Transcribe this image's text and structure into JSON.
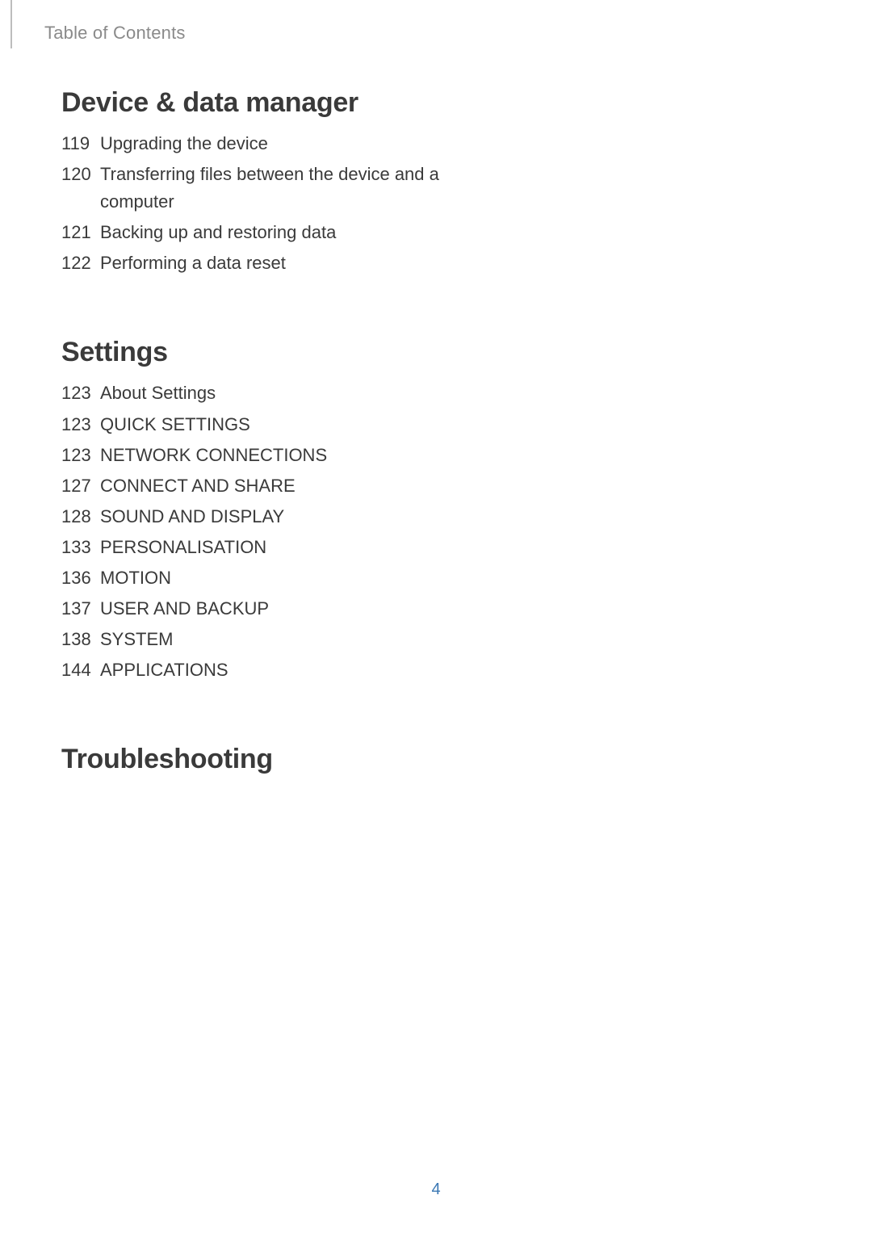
{
  "header": "Table of Contents",
  "sections": [
    {
      "title": "Device & data manager",
      "items": [
        {
          "page": "119",
          "text": "Upgrading the device"
        },
        {
          "page": "120",
          "text": "Transferring files between the device and a computer"
        },
        {
          "page": "121",
          "text": "Backing up and restoring data"
        },
        {
          "page": "122",
          "text": "Performing a data reset"
        }
      ]
    },
    {
      "title": "Settings",
      "items": [
        {
          "page": "123",
          "text": "About Settings"
        },
        {
          "page": "123",
          "text": "QUICK SETTINGS"
        },
        {
          "page": "123",
          "text": "NETWORK CONNECTIONS"
        },
        {
          "page": "127",
          "text": "CONNECT AND SHARE"
        },
        {
          "page": "128",
          "text": "SOUND AND DISPLAY"
        },
        {
          "page": "133",
          "text": "PERSONALISATION"
        },
        {
          "page": "136",
          "text": "MOTION"
        },
        {
          "page": "137",
          "text": "USER AND BACKUP"
        },
        {
          "page": "138",
          "text": "SYSTEM"
        },
        {
          "page": "144",
          "text": "APPLICATIONS"
        }
      ]
    },
    {
      "title": "Troubleshooting",
      "items": []
    }
  ],
  "pageNumber": "4"
}
